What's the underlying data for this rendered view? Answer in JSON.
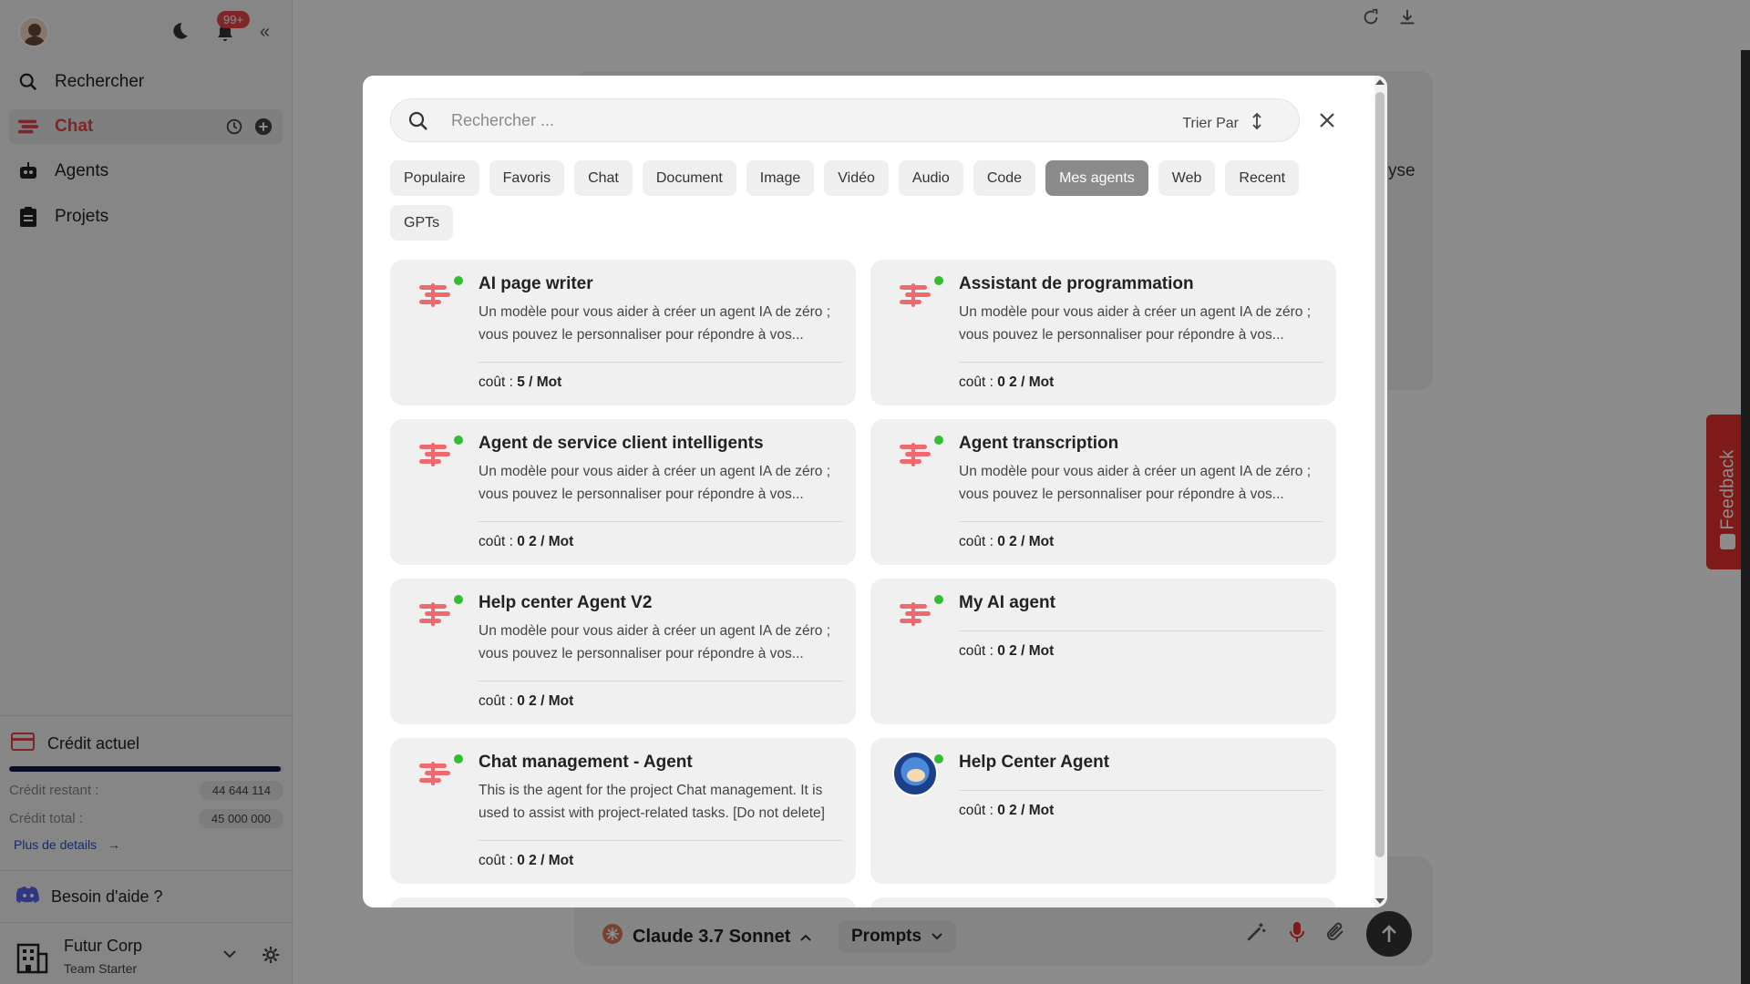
{
  "sidebar": {
    "notification_count": "99+",
    "nav": {
      "search": "Rechercher",
      "chat": "Chat",
      "agents": "Agents",
      "projects": "Projets"
    },
    "credit": {
      "title": "Crédit actuel",
      "remaining_label": "Crédit restant :",
      "remaining_value": "44 644 114",
      "total_label": "Crédit total :",
      "total_value": "45 000 000",
      "used_fraction": 0.99,
      "more_link": "Plus de details"
    },
    "help": "Besoin d'aide ?",
    "org": {
      "name": "Futur Corp",
      "plan": "Team Starter"
    }
  },
  "background": {
    "partial_text": "yse",
    "model": "Claude 3.7 Sonnet",
    "prompts": "Prompts",
    "feedback": "Feedback"
  },
  "modal": {
    "search_placeholder": "Rechercher ...",
    "sort_label": "Trier Par",
    "filters": [
      "Populaire",
      "Favoris",
      "Chat",
      "Document",
      "Image",
      "Vidéo",
      "Audio",
      "Code",
      "Mes agents",
      "Web",
      "Recent",
      "GPTs"
    ],
    "active_filter": "Mes agents",
    "cost_prefix": "coût :",
    "agents": [
      {
        "title": "AI page writer",
        "desc": "Un modèle pour vous aider à créer un agent IA de zéro ; vous pouvez le personnaliser pour répondre à vos...",
        "cost": "5 / Mot"
      },
      {
        "title": "Assistant de programmation",
        "desc": "Un modèle pour vous aider à créer un agent IA de zéro ; vous pouvez le personnaliser pour répondre à vos...",
        "cost": "0 2 / Mot"
      },
      {
        "title": "Agent de service client intelligents",
        "desc": "Un modèle pour vous aider à créer un agent IA de zéro ; vous pouvez le personnaliser pour répondre à vos...",
        "cost": "0 2 / Mot"
      },
      {
        "title": "Agent transcription",
        "desc": "Un modèle pour vous aider à créer un agent IA de zéro ; vous pouvez le personnaliser pour répondre à vos...",
        "cost": "0 2 / Mot"
      },
      {
        "title": "Help center Agent V2",
        "desc": "Un modèle pour vous aider à créer un agent IA de zéro ; vous pouvez le personnaliser pour répondre à vos...",
        "cost": "0 2 / Mot"
      },
      {
        "title": "My AI agent",
        "desc": "",
        "cost": "0 2 / Mot"
      },
      {
        "title": "Chat management - Agent",
        "desc": "This is the agent for the project Chat management. It is used to assist with project-related tasks. [Do not delete]",
        "cost": "0 2 / Mot"
      },
      {
        "title": "Help Center Agent",
        "desc": "",
        "cost": "0 2 / Mot"
      }
    ]
  },
  "colors": {
    "accent": "#e0484d",
    "online": "#2fbf2f",
    "active_chip": "#8b8b8b",
    "feedback": "#e5302a"
  }
}
